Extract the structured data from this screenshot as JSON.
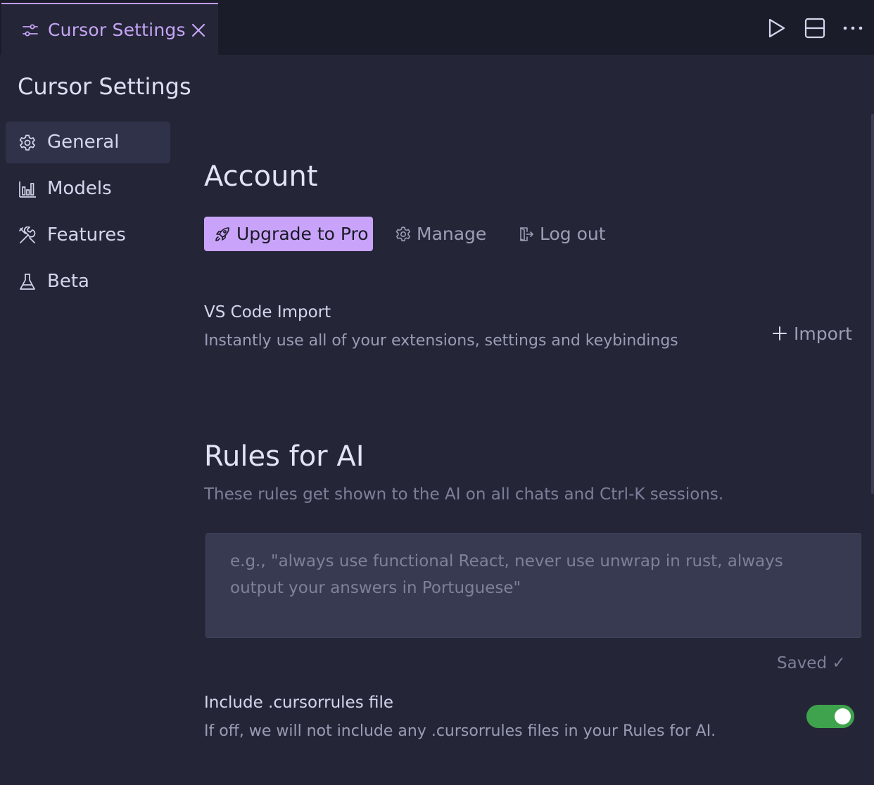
{
  "tab": {
    "title": "Cursor Settings",
    "icon": "settings-sliders-icon",
    "accent_color": "#c6a4f5"
  },
  "toolbar": {
    "run_icon": "play-icon",
    "split_icon": "split-editor-icon",
    "more_icon": "more-horizontal-icon"
  },
  "sidebar": {
    "title": "Cursor Settings",
    "items": [
      {
        "label": "General",
        "icon": "gear-icon",
        "active": true
      },
      {
        "label": "Models",
        "icon": "bar-chart-icon",
        "active": false
      },
      {
        "label": "Features",
        "icon": "tools-icon",
        "active": false
      },
      {
        "label": "Beta",
        "icon": "flask-icon",
        "active": false
      }
    ]
  },
  "account": {
    "heading": "Account",
    "upgrade_label": "Upgrade to Pro",
    "manage_label": "Manage",
    "logout_label": "Log out"
  },
  "vscode_import": {
    "title": "VS Code Import",
    "description": "Instantly use all of your extensions, settings and keybindings",
    "import_label": "Import"
  },
  "rules": {
    "heading": "Rules for AI",
    "description": "These rules get shown to the AI on all chats and Ctrl-K sessions.",
    "placeholder": "e.g., \"always use functional React, never use unwrap in rust, always output your answers in Portuguese\"",
    "value": "",
    "saved_label": "Saved ✓"
  },
  "cursorrules": {
    "title": "Include .cursorrules file",
    "description": "If off, we will not include any .cursorrules files in your Rules for AI.",
    "enabled": true,
    "toggle_color": "#3ea34c"
  }
}
